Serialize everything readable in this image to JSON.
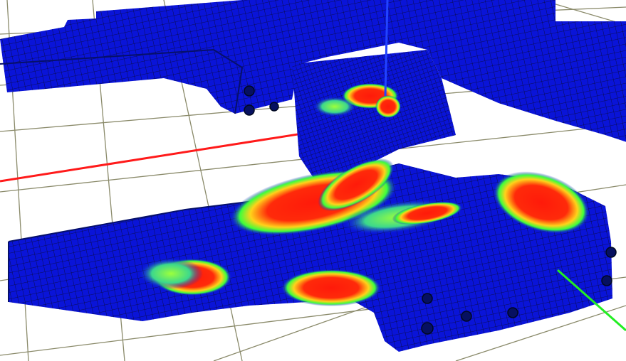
{
  "scene": {
    "kind": "fea-stress-contour-3d-viewport",
    "background_color": "#ffffff",
    "floor_grid_color": "#8a8a6a",
    "mesh_line_color": "#0a0a30",
    "axis_colors": {
      "x": "#ff1a1a",
      "y": "#22ee22",
      "z": "#2244ff"
    },
    "stress_colors": {
      "low": "#0a14d8",
      "mid": "#3cff3c",
      "high": "#ff1a0a"
    }
  }
}
